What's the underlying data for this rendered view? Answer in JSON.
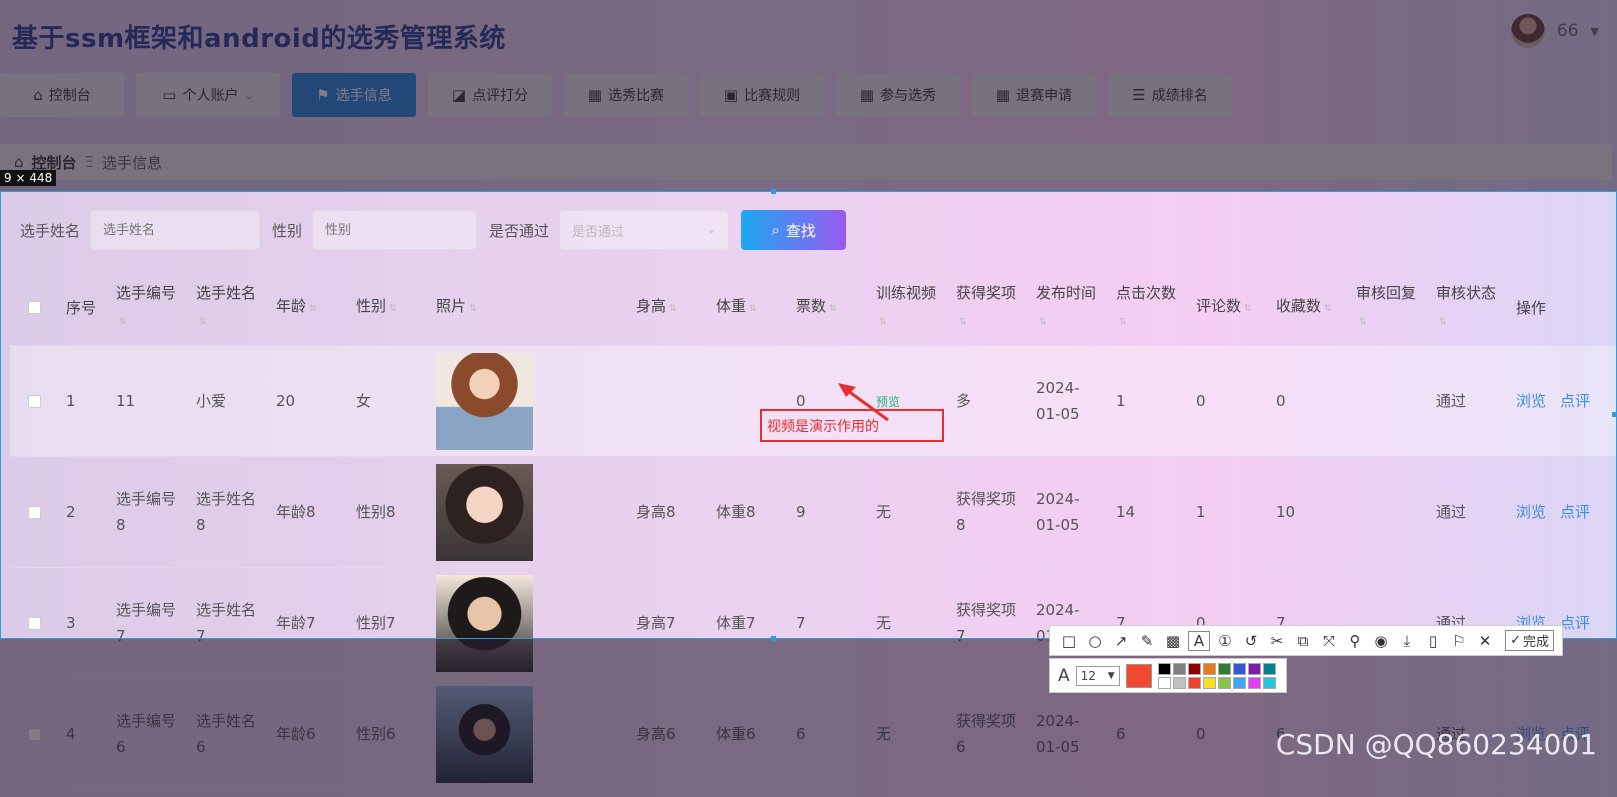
{
  "site_title": "基于ssm框架和android的选秀管理系统",
  "user": {
    "name": "66"
  },
  "nav": [
    {
      "label": "控制台",
      "icon": "home-icon"
    },
    {
      "label": "个人账户",
      "icon": "card-icon",
      "dropdown": true
    },
    {
      "label": "选手信息",
      "icon": "flag-icon",
      "active": true
    },
    {
      "label": "点评打分",
      "icon": "chart-icon"
    },
    {
      "label": "选秀比赛",
      "icon": "grid-icon"
    },
    {
      "label": "比赛规则",
      "icon": "clipboard-icon"
    },
    {
      "label": "参与选秀",
      "icon": "grid-icon"
    },
    {
      "label": "退赛申请",
      "icon": "grid-icon"
    },
    {
      "label": "成绩排名",
      "icon": "sliders-icon"
    }
  ],
  "breadcrumb": {
    "home": "控制台",
    "current": "选手信息"
  },
  "selection_size_label": "9 × 448",
  "search": {
    "name_label": "选手姓名",
    "name_placeholder": "选手姓名",
    "sex_label": "性别",
    "sex_placeholder": "性别",
    "pass_label": "是否通过",
    "pass_placeholder": "是否通过",
    "button": "查找"
  },
  "table": {
    "headers": [
      "序号",
      "选手编号",
      "选手姓名",
      "年龄",
      "性别",
      "照片",
      "身高",
      "体重",
      "票数",
      "训练视频",
      "获得奖项",
      "发布时间",
      "点击次数",
      "评论数",
      "收藏数",
      "审核回复",
      "审核状态",
      "操作"
    ],
    "rows": [
      {
        "no": "1",
        "code": "11",
        "name": "小爱",
        "age": "20",
        "sex": "女",
        "height": "",
        "weight": "",
        "votes": "0",
        "video": "预览",
        "award": "多",
        "time": "2024-01-05",
        "clicks": "1",
        "comments": "0",
        "favs": "0",
        "reply": "",
        "status": "通过"
      },
      {
        "no": "2",
        "code": "选手编号8",
        "name": "选手姓名8",
        "age": "年龄8",
        "sex": "性别8",
        "height": "身高8",
        "weight": "体重8",
        "votes": "9",
        "video": "无",
        "award": "获得奖项8",
        "time": "2024-01-05",
        "clicks": "14",
        "comments": "1",
        "favs": "10",
        "reply": "",
        "status": "通过"
      },
      {
        "no": "3",
        "code": "选手编号7",
        "name": "选手姓名7",
        "age": "年龄7",
        "sex": "性别7",
        "height": "身高7",
        "weight": "体重7",
        "votes": "7",
        "video": "无",
        "award": "获得奖项7",
        "time": "2024-01-05",
        "clicks": "7",
        "comments": "0",
        "favs": "7",
        "reply": "",
        "status": "通过"
      },
      {
        "no": "4",
        "code": "选手编号6",
        "name": "选手姓名6",
        "age": "年龄6",
        "sex": "性别6",
        "height": "身高6",
        "weight": "体重6",
        "votes": "6",
        "video": "无",
        "award": "获得奖项6",
        "time": "2024-01-05",
        "clicks": "6",
        "comments": "0",
        "favs": "6",
        "reply": "",
        "status": "通过"
      }
    ],
    "op_view": "浏览",
    "op_review": "点评"
  },
  "annotation": {
    "text": "视频是演示作用的",
    "color": "#e52e2e"
  },
  "screenshot_toolbar": {
    "done_label": "完成",
    "font_size": "12",
    "current_color": "#f0492f",
    "palette": [
      "#000000",
      "#808080",
      "#8b0000",
      "#e07b20",
      "#2e7d32",
      "#3457d5",
      "#7b1fa2",
      "#00838f",
      "#ffffff",
      "#c0c0c0",
      "#f04030",
      "#f5e020",
      "#8bc34a",
      "#42a5f5",
      "#e040fb",
      "#26c6da"
    ]
  },
  "watermark": "CSDN @QQ860234001",
  "colors": {
    "accent": "#1e84d6",
    "link": "#3a8ee6",
    "title": "#233a8c"
  }
}
